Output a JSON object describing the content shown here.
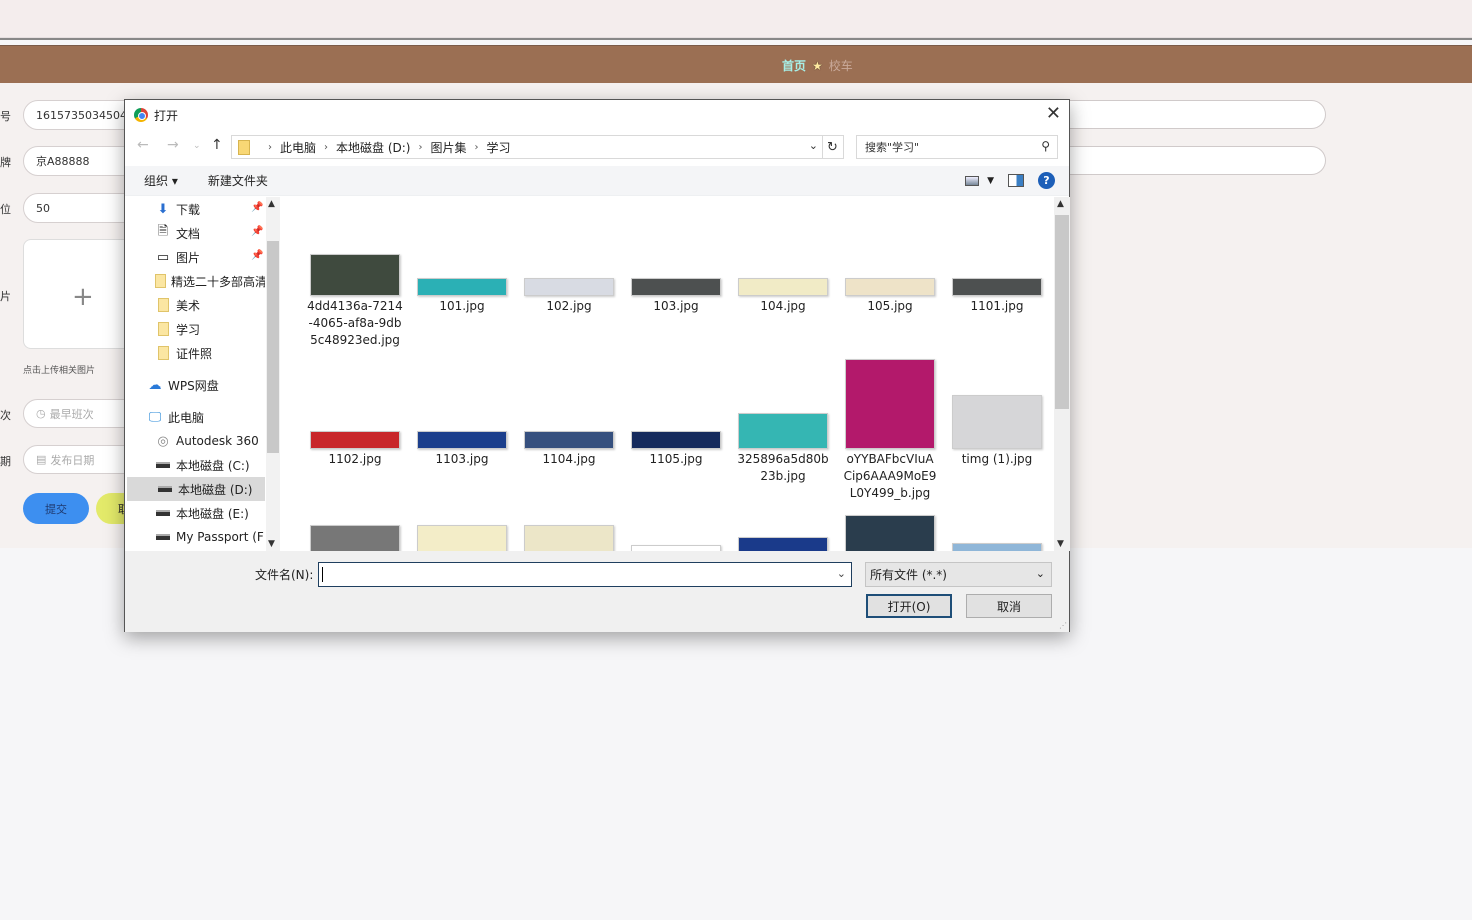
{
  "nav": {
    "home": "首页",
    "star_icon": "star",
    "car": "校车"
  },
  "form": {
    "fields": [
      {
        "label": "号",
        "value": "1615735034504"
      },
      {
        "label": "牌",
        "value": "京A88888"
      },
      {
        "label": "位",
        "value": "50"
      },
      {
        "label": "片",
        "value": ""
      },
      {
        "label": "次",
        "placeholder": "最早班次"
      },
      {
        "label": "期",
        "placeholder": "发布日期"
      }
    ],
    "upload_hint": "点击上传相关图片",
    "submit": "提交",
    "cancel": "取"
  },
  "dialog": {
    "title": "打开",
    "breadcrumb": [
      "此电脑",
      "本地磁盘 (D:)",
      "图片集",
      "学习"
    ],
    "search_placeholder": "搜索\"学习\"",
    "toolbar": {
      "organize": "组织 ▾",
      "new_folder": "新建文件夹"
    },
    "sidebar": [
      {
        "label": "下载",
        "icon": "download-icon",
        "pinned": true
      },
      {
        "label": "文档",
        "icon": "document-icon",
        "pinned": true
      },
      {
        "label": "图片",
        "icon": "pictures-icon",
        "pinned": true
      },
      {
        "label": "精选二十多部高清",
        "icon": "folder-icon"
      },
      {
        "label": "美术",
        "icon": "folder-icon"
      },
      {
        "label": "学习",
        "icon": "folder-icon"
      },
      {
        "label": "证件照",
        "icon": "folder-icon"
      },
      {
        "label": "WPS网盘",
        "icon": "cloud-icon"
      },
      {
        "label": "此电脑",
        "icon": "computer-icon"
      },
      {
        "label": "Autodesk 360",
        "icon": "autodesk-icon"
      },
      {
        "label": "本地磁盘 (C:)",
        "icon": "drive-icon"
      },
      {
        "label": "本地磁盘 (D:)",
        "icon": "drive-icon",
        "selected": true
      },
      {
        "label": "本地磁盘 (E:)",
        "icon": "drive-icon"
      },
      {
        "label": "My Passport (F",
        "icon": "drive-icon"
      }
    ],
    "files": [
      {
        "name": "4dd4136a-7214-4065-af8a-9db5c48923ed.jpg",
        "lines": [
          "4dd4136a-7214",
          "-4065-af8a-9db",
          "5c48923ed.jpg"
        ],
        "color": "#3f4a3e"
      },
      {
        "name": "101.jpg",
        "lines": [
          "101.jpg"
        ],
        "color": "#2bb0b5"
      },
      {
        "name": "102.jpg",
        "lines": [
          "102.jpg"
        ],
        "color": "#d8dbe3"
      },
      {
        "name": "103.jpg",
        "lines": [
          "103.jpg"
        ],
        "color": "#4d5050"
      },
      {
        "name": "104.jpg",
        "lines": [
          "104.jpg"
        ],
        "color": "#f1ebc6"
      },
      {
        "name": "105.jpg",
        "lines": [
          "105.jpg"
        ],
        "color": "#eee3c8"
      },
      {
        "name": "1101.jpg",
        "lines": [
          "1101.jpg"
        ],
        "color": "#4d5050"
      },
      {
        "name": "1102.jpg",
        "lines": [
          "1102.jpg"
        ],
        "color": "#c8262a"
      },
      {
        "name": "1103.jpg",
        "lines": [
          "1103.jpg"
        ],
        "color": "#1c3f8c"
      },
      {
        "name": "1104.jpg",
        "lines": [
          "1104.jpg"
        ],
        "color": "#36507e"
      },
      {
        "name": "1105.jpg",
        "lines": [
          "1105.jpg"
        ],
        "color": "#152a5c"
      },
      {
        "name": "325896a5d80b23b.jpg",
        "lines": [
          "325896a5d80b",
          "23b.jpg"
        ],
        "color": "#35b6b3"
      },
      {
        "name": "oYYBAFbcVIuACip6AAA9MoE9L0Y499_b.jpg",
        "lines": [
          "oYYBAFbcVIuA",
          "Cip6AAA9MoE9",
          "L0Y499_b.jpg"
        ],
        "color": "#b3196b"
      },
      {
        "name": "timg (1).jpg",
        "lines": [
          "timg (1).jpg"
        ],
        "color": "#d6d6d8"
      },
      {
        "name": "",
        "lines": [],
        "color": "#777777"
      },
      {
        "name": "",
        "lines": [],
        "color": "#f3edc8"
      },
      {
        "name": "",
        "lines": [],
        "color": "#ece6c8"
      },
      {
        "name": "",
        "lines": [],
        "color": "#ffffff"
      },
      {
        "name": "",
        "lines": [],
        "color": "#1a3a8a"
      },
      {
        "name": "",
        "lines": [],
        "color": "#2a3d4d"
      },
      {
        "name": "",
        "lines": [],
        "color": "#8fb6d8"
      }
    ],
    "filename_label": "文件名(N):",
    "filename_value": "",
    "filetype": "所有文件 (*.*)",
    "open": "打开(O)",
    "cancel": "取消"
  }
}
